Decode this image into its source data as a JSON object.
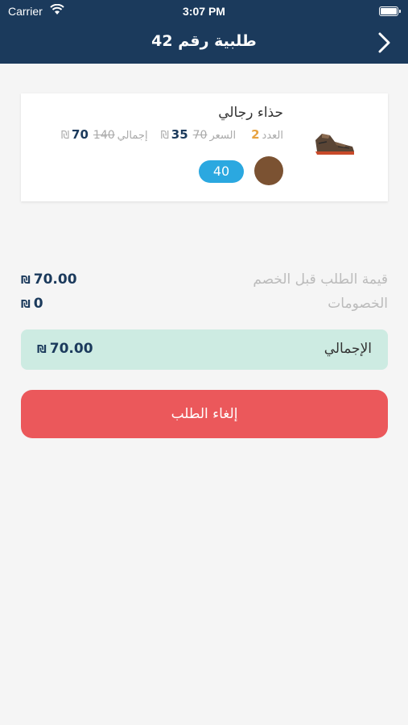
{
  "status_bar": {
    "carrier": "Carrier",
    "time": "3:07 PM"
  },
  "header": {
    "title": "طلبية رقم 42"
  },
  "item": {
    "name": "حذاء رجالي",
    "qty_label": "العدد",
    "qty": "2",
    "price_label": "السعر",
    "price": "35",
    "price_old": "70",
    "total_label": "إجمالي",
    "total": "70",
    "total_old": "140",
    "currency": "₪",
    "size": "40",
    "color": "#7b5232"
  },
  "summary": {
    "before_discount_label": "قيمة الطلب قبل الخصم",
    "before_discount_value": "70.00",
    "discounts_label": "الخصومات",
    "discounts_value": "0",
    "currency": "₪"
  },
  "total": {
    "label": "الإجمالي",
    "value": "70.00",
    "currency": "₪"
  },
  "actions": {
    "cancel_label": "إلغاء الطلب"
  },
  "colors": {
    "header": "#1b3a5c",
    "accent_blue": "#2ba8e0",
    "cancel": "#eb585b",
    "total_bg": "#cdebe2",
    "qty": "#e8a341"
  }
}
